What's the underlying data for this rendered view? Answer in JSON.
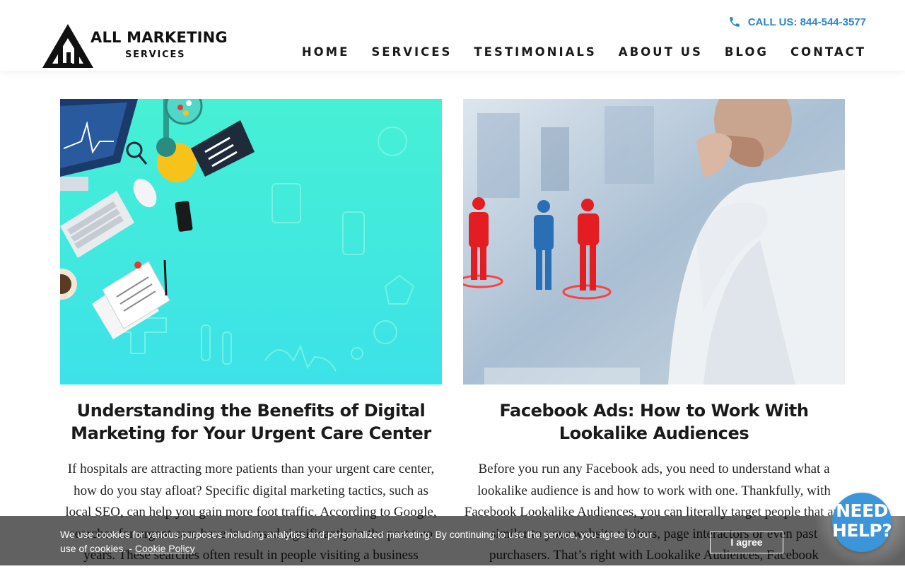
{
  "header": {
    "logo": {
      "line1": "ALL MARKETING",
      "line2": "SERVICES"
    },
    "call_label": "CALL US: 844-544-3577",
    "nav": [
      "HOME",
      "SERVICES",
      "TESTIMONIALS",
      "ABOUT US",
      "BLOG",
      "CONTACT"
    ]
  },
  "posts": [
    {
      "title": "Understanding the Benefits of Digital Marketing for Your Urgent Care Center",
      "excerpt": "If hospitals are attracting more patients than your urgent care center, how do you stay afloat? Specific digital marketing tactics, such as local SEO, can help you gain more foot traffic. According to Google, searches for urgent care have increased significantly in the past two years. These searches often result in people visiting a business"
    },
    {
      "title": "Facebook Ads: How to Work With Lookalike Audiences",
      "excerpt": "Before you run any Facebook ads, you need to understand what a lookalike audience is and how to work with one. Thankfully, with Facebook Lookalike Audiences, you can literally target people that are similar to your website visitors, page interactors or even past purchasers. That’s right with Lookalike Audiences, Facebook"
    }
  ],
  "cookie": {
    "text": "We use cookies for various purposes including analytics and personalized marketing. By continuing to use the service, you agree to our use of cookies. - ",
    "link": "Cookie Policy",
    "button": "I agree"
  },
  "help": {
    "line1": "NEED",
    "line2": "HELP?"
  },
  "colors": {
    "accent": "#2a87c7",
    "help_bubble": "#3b95d8",
    "cookie_bar": "rgba(0,0,0,0.62)"
  },
  "icons": [
    "phone-icon",
    "logo-triangle-icon"
  ]
}
